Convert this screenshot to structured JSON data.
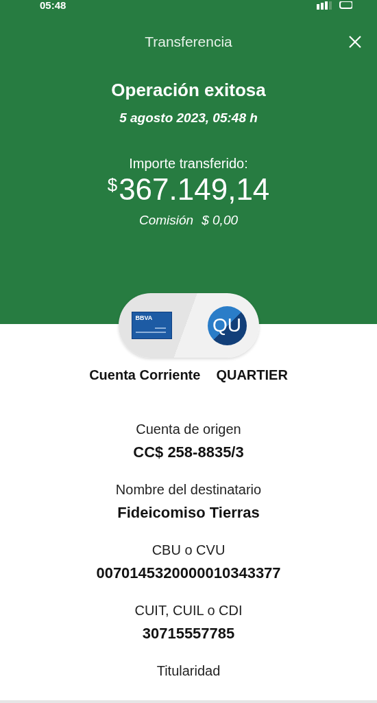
{
  "status_bar": {
    "time": "05:48"
  },
  "header": {
    "title": "Transferencia"
  },
  "result": {
    "title": "Operación exitosa",
    "date": "5 agosto 2023, 05:48 h",
    "amount_label": "Importe transferido:",
    "currency": "$",
    "amount": "367.149,14",
    "fee_label": "Comisión",
    "fee": "$ 0,00"
  },
  "parties": {
    "origin_card": "BBVA",
    "destination_initials": "QU",
    "origin_name": "Cuenta Corriente",
    "destination_name": "QUARTIER"
  },
  "details": [
    {
      "label": "Cuenta de origen",
      "value": "CC$ 258-8835/3"
    },
    {
      "label": "Nombre del destinatario",
      "value": "Fideicomiso Tierras"
    },
    {
      "label": "CBU o CVU",
      "value": "0070145320000010343377"
    },
    {
      "label": "CUIT, CUIL o CDI",
      "value": "30715557785"
    },
    {
      "label": "Titularidad"
    }
  ]
}
